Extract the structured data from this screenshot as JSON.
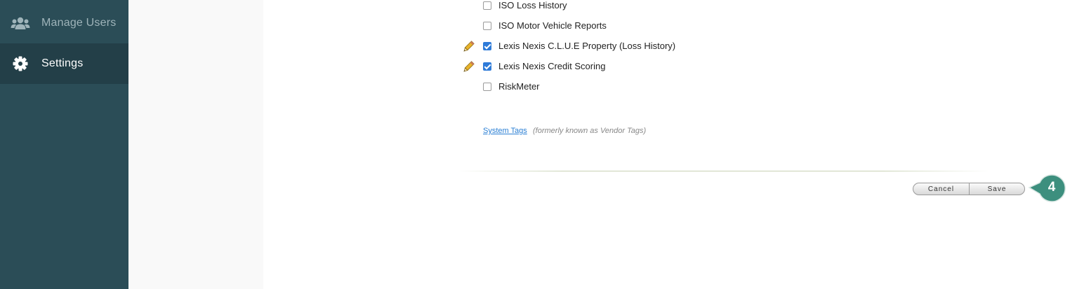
{
  "sidebar": {
    "items": [
      {
        "label": "Manage Users",
        "icon": "users-icon"
      },
      {
        "label": "Settings",
        "icon": "gear-icon"
      }
    ]
  },
  "options": [
    {
      "label": "ISO Loss History",
      "checked": false,
      "editable": false
    },
    {
      "label": "ISO Motor Vehicle Reports",
      "checked": false,
      "editable": false
    },
    {
      "label": "Lexis Nexis C.L.U.E Property (Loss History)",
      "checked": true,
      "editable": true
    },
    {
      "label": "Lexis Nexis Credit Scoring",
      "checked": true,
      "editable": true
    },
    {
      "label": "RiskMeter",
      "checked": false,
      "editable": false
    }
  ],
  "tags": {
    "link_label": "System Tags",
    "note": "(formerly known as Vendor Tags)"
  },
  "actions": {
    "cancel_label": "Cancel",
    "save_label": "Save"
  },
  "step_marker": {
    "number": "4",
    "color": "#3d8f7e"
  },
  "colors": {
    "sidebar": "#2b4d57",
    "sidebar_active": "#233f48",
    "checkbox_checked": "#2f7bd8",
    "link": "#2a7fd4"
  }
}
